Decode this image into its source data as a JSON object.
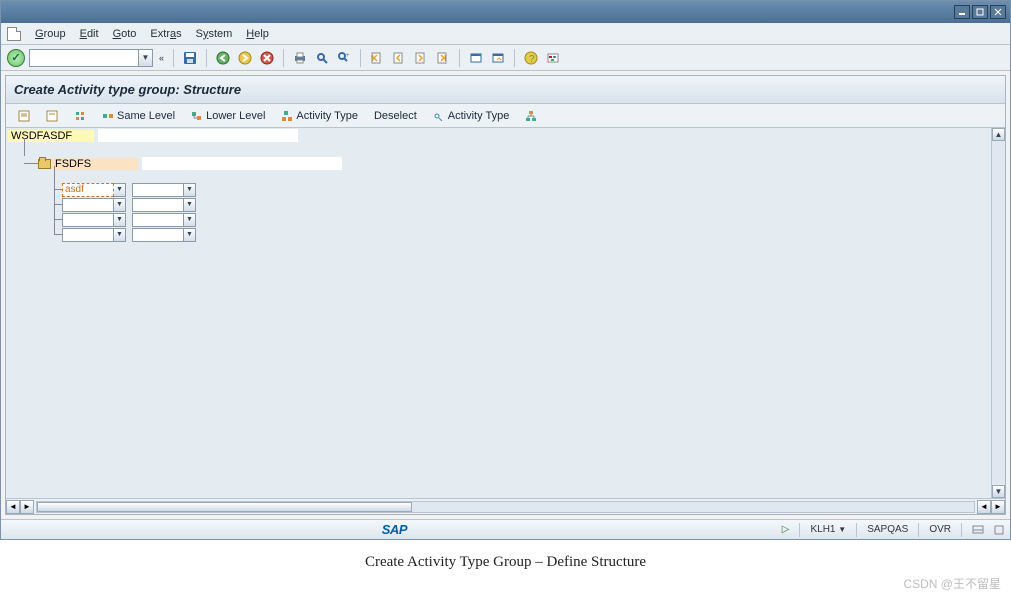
{
  "menubar": {
    "items": [
      "Group",
      "Edit",
      "Goto",
      "Extras",
      "System",
      "Help"
    ]
  },
  "panel": {
    "title": "Create Activity type group: Structure"
  },
  "app_toolbar": {
    "same_level": "Same Level",
    "lower_level": "Lower Level",
    "activity_type": "Activity Type",
    "deselect": "Deselect",
    "activity_type2": "Activity Type"
  },
  "tree": {
    "root": "WSDFASDF",
    "child1": "FSDFS",
    "active_input": "asdf",
    "rows_blank": [
      "",
      "",
      "",
      ""
    ]
  },
  "statusbar": {
    "field1": "KLH1",
    "field2": "SAPQAS",
    "mode": "OVR"
  },
  "caption": "Create Activity Type Group – Define Structure",
  "watermark": "CSDN @王不留星",
  "sap_logo": "SAP"
}
